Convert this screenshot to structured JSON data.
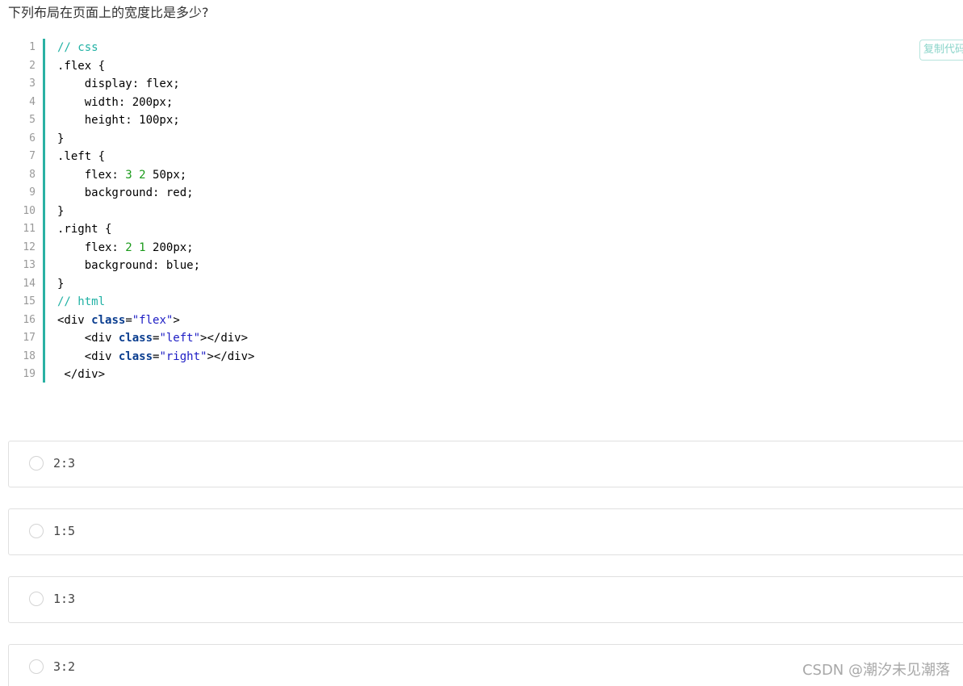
{
  "question": {
    "title": "下列布局在页面上的宽度比是多少?"
  },
  "code": {
    "copy_label": "复制代码",
    "line_numbers": [
      "1",
      "2",
      "3",
      "4",
      "5",
      "6",
      "7",
      "8",
      "9",
      "10",
      "11",
      "12",
      "13",
      "14",
      "15",
      "16",
      "17",
      "18",
      "19"
    ],
    "lines": [
      [
        {
          "t": "// css",
          "c": "comment"
        }
      ],
      [
        {
          "t": ".flex {",
          "c": ""
        }
      ],
      [
        {
          "t": "    display: flex;",
          "c": ""
        }
      ],
      [
        {
          "t": "    width: 200px;",
          "c": ""
        }
      ],
      [
        {
          "t": "    height: 100px;",
          "c": ""
        }
      ],
      [
        {
          "t": "}",
          "c": ""
        }
      ],
      [
        {
          "t": ".left {",
          "c": ""
        }
      ],
      [
        {
          "t": "    flex: ",
          "c": ""
        },
        {
          "t": "3",
          "c": "num"
        },
        {
          "t": " ",
          "c": ""
        },
        {
          "t": "2",
          "c": "num"
        },
        {
          "t": " 50px;",
          "c": ""
        }
      ],
      [
        {
          "t": "    background: red;",
          "c": ""
        }
      ],
      [
        {
          "t": "}",
          "c": ""
        }
      ],
      [
        {
          "t": ".right {",
          "c": ""
        }
      ],
      [
        {
          "t": "    flex: ",
          "c": ""
        },
        {
          "t": "2",
          "c": "num"
        },
        {
          "t": " ",
          "c": ""
        },
        {
          "t": "1",
          "c": "num"
        },
        {
          "t": " 200px;",
          "c": ""
        }
      ],
      [
        {
          "t": "    background: blue;",
          "c": ""
        }
      ],
      [
        {
          "t": "}",
          "c": ""
        }
      ],
      [
        {
          "t": "// html",
          "c": "comment"
        }
      ],
      [
        {
          "t": "<div ",
          "c": ""
        },
        {
          "t": "class",
          "c": "kw"
        },
        {
          "t": "=",
          "c": ""
        },
        {
          "t": "\"flex\"",
          "c": "str"
        },
        {
          "t": ">",
          "c": ""
        }
      ],
      [
        {
          "t": "    <div ",
          "c": ""
        },
        {
          "t": "class",
          "c": "kw"
        },
        {
          "t": "=",
          "c": ""
        },
        {
          "t": "\"left\"",
          "c": "str"
        },
        {
          "t": "></div>",
          "c": ""
        }
      ],
      [
        {
          "t": "    <div ",
          "c": ""
        },
        {
          "t": "class",
          "c": "kw"
        },
        {
          "t": "=",
          "c": ""
        },
        {
          "t": "\"right\"",
          "c": "str"
        },
        {
          "t": "></div>",
          "c": ""
        }
      ],
      [
        {
          "t": " </div>",
          "c": ""
        }
      ]
    ]
  },
  "options": [
    {
      "label": "2:3"
    },
    {
      "label": "1:5"
    },
    {
      "label": "1:3"
    },
    {
      "label": "3:2"
    }
  ],
  "watermark": {
    "text": "CSDN @潮汐未见潮落"
  },
  "colors": {
    "accent": "#2ab1a3",
    "comment": "#20b1a4",
    "number": "#1a9a1a",
    "keyword": "#0a3d8f",
    "string": "#1c1cc4"
  }
}
